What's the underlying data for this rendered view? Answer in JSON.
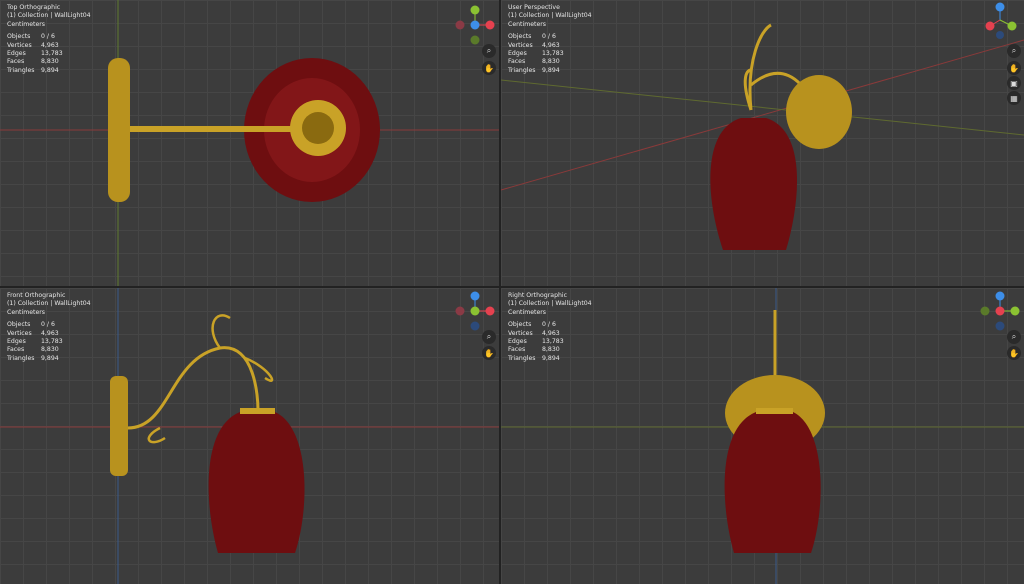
{
  "viewports": [
    {
      "view": "Top Orthographic",
      "collection": "(1) Collection | WallLight04",
      "units": "Centimeters"
    },
    {
      "view": "User Perspective",
      "collection": "(1) Collection | WallLight04",
      "units": "Centimeters"
    },
    {
      "view": "Front Orthographic",
      "collection": "(1) Collection | WallLight04",
      "units": "Centimeters"
    },
    {
      "view": "Right Orthographic",
      "collection": "(1) Collection | WallLight04",
      "units": "Centimeters"
    }
  ],
  "stats": {
    "labels": [
      "Objects",
      "Vertices",
      "Edges",
      "Faces",
      "Triangles"
    ],
    "values": [
      "0 / 6",
      "4,963",
      "13,783",
      "8,830",
      "9,894"
    ]
  },
  "gizmo_labels": {
    "x": "X",
    "y": "Y",
    "z": "Z"
  },
  "icons": [
    "zoom-icon",
    "hand-pan-icon",
    "camera-icon",
    "grid-view-icon"
  ],
  "colors": {
    "x_axis": "#e5414f",
    "y_axis": "#8bc232",
    "z_axis": "#3d8ee8",
    "gold": "#c9a227",
    "red_glass": "#7a0f12"
  }
}
